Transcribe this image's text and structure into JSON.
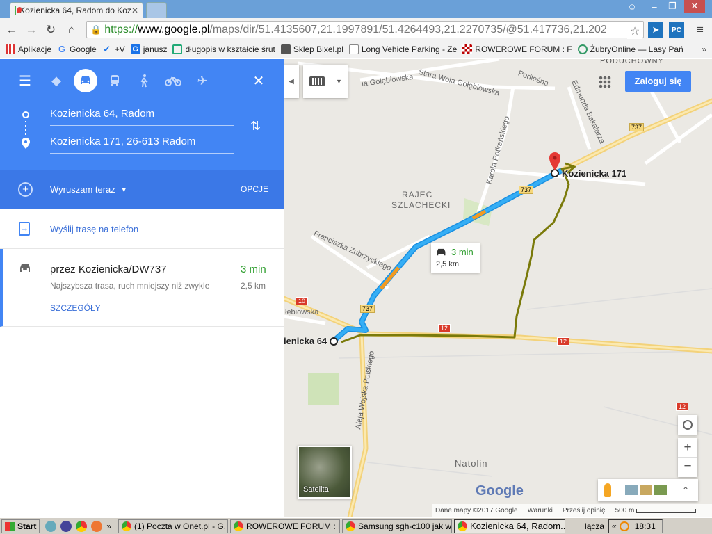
{
  "browser": {
    "tabs": [
      {
        "label": "Kozienicka 64, Radom do Koz"
      },
      {
        "label": ""
      }
    ],
    "url_scheme": "https://",
    "url_host": "www.google.pl",
    "url_path": "/maps/dir/51.4135607,21.1997891/51.4264493,21.2270735/@51.417736,21.202",
    "bookmarks": [
      {
        "label": "Aplikacje",
        "icon": "apps-grid-icon",
        "color": "#d33"
      },
      {
        "label": "Google",
        "icon": "google-g-icon",
        "color": "#4285f4"
      },
      {
        "label": "+V",
        "icon": "v-check-icon",
        "color": "#1a73e8"
      },
      {
        "label": "janusz",
        "icon": "g-square-icon",
        "color": "#1a73e8"
      },
      {
        "label": "długopis w kształcie śrut",
        "icon": "page-icon",
        "color": "#2a7"
      },
      {
        "label": "Sklep Bixel.pl",
        "icon": "cart-icon",
        "color": "#555"
      },
      {
        "label": "Long Vehicle Parking - Ze",
        "icon": "doc-icon",
        "color": "#888"
      },
      {
        "label": "ROWEROWE FORUM : F",
        "icon": "checker-icon",
        "color": "#b00"
      },
      {
        "label": "ŻubryOnline — Lasy Pań",
        "icon": "globe-icon",
        "color": "#396"
      }
    ]
  },
  "panel": {
    "origin": "Kozienicka 64, Radom",
    "destination": "Kozienicka 171, 26-613 Radom",
    "depart_label": "Wyruszam teraz",
    "options_label": "OPCJE",
    "send_label": "Wyślij trasę na telefon",
    "route": {
      "via": "przez Kozienicka/DW737",
      "time": "3 min",
      "note": "Najszybsza trasa, ruch mniejszy niż zwykle",
      "distance": "2,5 km",
      "details": "SZCZEGÓŁY"
    }
  },
  "map": {
    "login": "Zaloguj się",
    "labels": {
      "poduchowny": "PODUCHOWNY",
      "golebiowska": "ia Gołębiowska",
      "stara_wola": "Stara Wola Gołębiowska",
      "podlesna": "Podleśna",
      "bakalarza": "Edmunda Bakalarza",
      "potkanskiego": "Karola Potkańskiego",
      "rajec1": "RAJEC",
      "rajec2": "SZLACHECKI",
      "zubrzyckiego": "Franciszka Zubrzyckiego",
      "golebiowska2": "łębiowska",
      "wojska": "Aleja Wojska Polskiego",
      "natolin": "Natolin",
      "kozienicka64": "ienicka 64",
      "kozienicka171": "Kozienicka 171",
      "r737a": "737",
      "r737b": "737",
      "r737c": "737",
      "r12a": "12",
      "r12b": "12",
      "r12c": "12",
      "r10": "10"
    },
    "bubble": {
      "time": "3 min",
      "distance": "2,5 km"
    },
    "satellite": "Satelita",
    "google": "Google",
    "footer": {
      "data": "Dane mapy ©2017 Google",
      "terms": "Warunki",
      "feedback": "Prześlij opinię",
      "scale": "500 m"
    },
    "zoom_in": "+",
    "zoom_out": "−"
  },
  "taskbar": {
    "start": "Start",
    "tasks": [
      {
        "label": "(1) Poczta w Onet.pl - G..."
      },
      {
        "label": "ROWEROWE FORUM : F..."
      },
      {
        "label": "Samsung sgh-c100 jak w..."
      },
      {
        "label": "Kozienicka 64, Radom..."
      }
    ],
    "links": "łącza",
    "clock": "18:31"
  },
  "colors": {
    "accent": "#4285f4",
    "route": "#2aa7f0",
    "track": "#7a7a0a",
    "road_yellow": "#f6d77a"
  }
}
